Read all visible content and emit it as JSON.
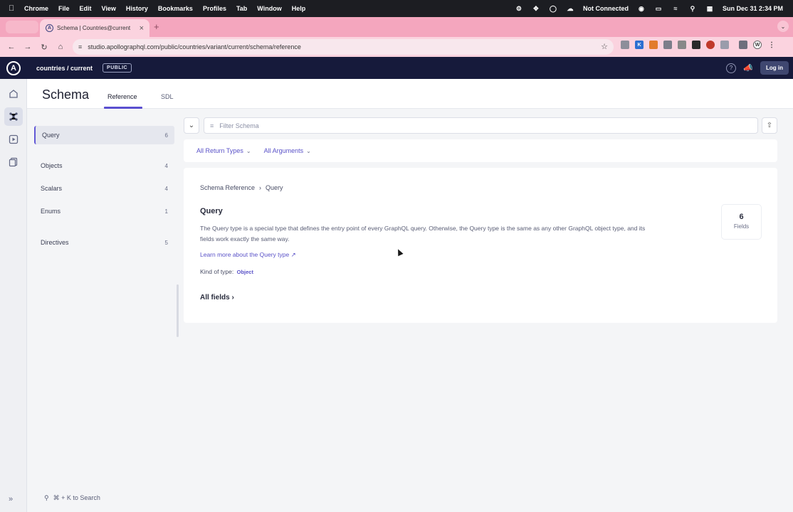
{
  "mac_menubar": {
    "app": "Chrome",
    "menus": [
      "File",
      "Edit",
      "View",
      "History",
      "Bookmarks",
      "Profiles",
      "Tab",
      "Window",
      "Help"
    ],
    "network_status": "Not Connected",
    "datetime": "Sun Dec 31  2:34 PM"
  },
  "browser": {
    "tab_title": "Schema | Countries@current",
    "url": "studio.apollographql.com/public/countries/variant/current/schema/reference",
    "extension_labels": [
      "K",
      "W"
    ]
  },
  "studio_header": {
    "graph_name": "countries / current",
    "visibility_badge": "PUBLIC",
    "login_label": "Log in"
  },
  "page": {
    "title": "Schema",
    "tabs": [
      {
        "label": "Reference",
        "active": true
      },
      {
        "label": "SDL",
        "active": false
      }
    ]
  },
  "sidebar": {
    "items": [
      {
        "label": "Query",
        "count": "6",
        "active": true
      },
      {
        "label": "Objects",
        "count": "4"
      },
      {
        "label": "Scalars",
        "count": "4"
      },
      {
        "label": "Enums",
        "count": "1"
      },
      {
        "label": "Directives",
        "count": "5"
      }
    ],
    "search_hint": "⌘ + K to Search"
  },
  "filter": {
    "placeholder": "Filter Schema",
    "return_types_label": "All Return Types",
    "arguments_label": "All Arguments"
  },
  "detail": {
    "breadcrumb_root": "Schema Reference",
    "breadcrumb_current": "Query",
    "type_name": "Query",
    "description": "The Query type is a special type that defines the entry point of every GraphQL query. Otherwise, the Query type is the same as any other GraphQL object type, and its fields work exactly the same way.",
    "learn_more": "Learn more about the Query type",
    "kind_label": "Kind of type:",
    "kind_value": "Object",
    "all_fields_label": "All fields",
    "fields_count": "6",
    "fields_label": "Fields"
  }
}
